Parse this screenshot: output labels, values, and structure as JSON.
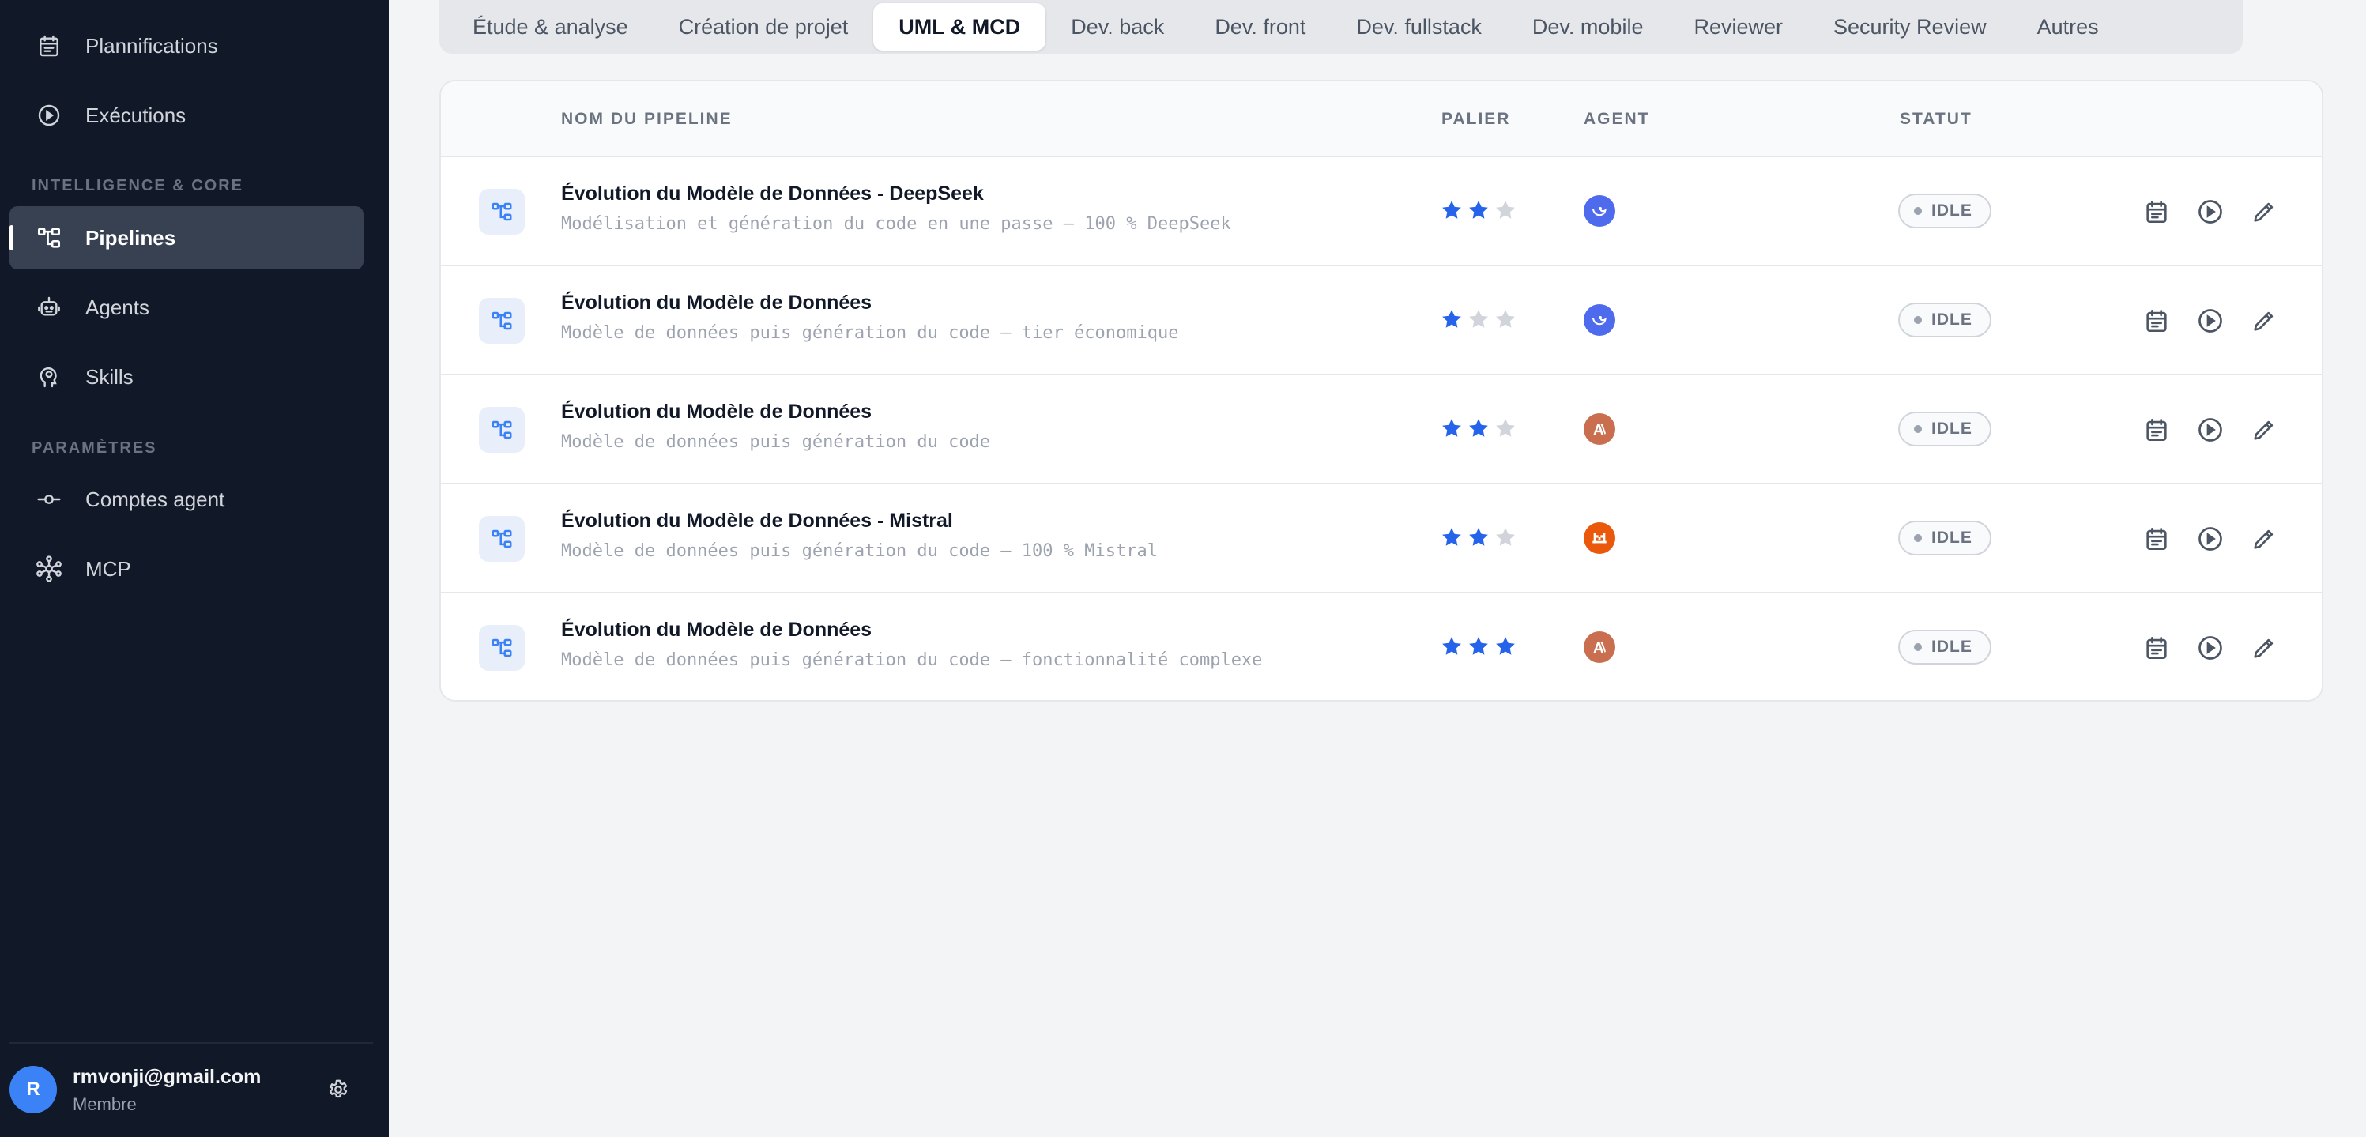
{
  "sidebar": {
    "items_top": [
      {
        "label": "Plannifications",
        "icon": "calendar-icon"
      },
      {
        "label": "Exécutions",
        "icon": "play-circle-icon"
      }
    ],
    "section_core": "INTELLIGENCE & CORE",
    "items_core": [
      {
        "label": "Pipelines",
        "icon": "pipeline-icon",
        "active": true
      },
      {
        "label": "Agents",
        "icon": "robot-icon"
      },
      {
        "label": "Skills",
        "icon": "skill-head-icon"
      }
    ],
    "section_params": "PARAMÈTRES",
    "items_params": [
      {
        "label": "Comptes agent",
        "icon": "commit-icon"
      },
      {
        "label": "MCP",
        "icon": "network-icon"
      }
    ],
    "user": {
      "initial": "R",
      "email": "rmvonji@gmail.com",
      "role": "Membre"
    }
  },
  "tabs": [
    {
      "label": "Étude & analyse"
    },
    {
      "label": "Création de projet"
    },
    {
      "label": "UML & MCD",
      "active": true
    },
    {
      "label": "Dev. back"
    },
    {
      "label": "Dev. front"
    },
    {
      "label": "Dev. fullstack"
    },
    {
      "label": "Dev. mobile"
    },
    {
      "label": "Reviewer"
    },
    {
      "label": "Security Review"
    },
    {
      "label": "Autres"
    }
  ],
  "table": {
    "headers": {
      "name": "NOM DU PIPELINE",
      "tier": "PALIER",
      "agent": "AGENT",
      "status": "STATUT"
    },
    "rows": [
      {
        "name": "Évolution du Modèle de Données - DeepSeek",
        "desc": "Modélisation et génération du code en une passe — 100 % DeepSeek",
        "tier": 2,
        "agent": "deepseek",
        "status": "IDLE"
      },
      {
        "name": "Évolution du Modèle de Données",
        "desc": "Modèle de données puis génération du code — tier économique",
        "tier": 1,
        "agent": "deepseek",
        "status": "IDLE"
      },
      {
        "name": "Évolution du Modèle de Données",
        "desc": "Modèle de données puis génération du code",
        "tier": 2,
        "agent": "anthropic",
        "status": "IDLE"
      },
      {
        "name": "Évolution du Modèle de Données - Mistral",
        "desc": "Modèle de données puis génération du code — 100 % Mistral",
        "tier": 2,
        "agent": "mistral",
        "status": "IDLE"
      },
      {
        "name": "Évolution du Modèle de Données",
        "desc": "Modèle de données puis génération du code — fonctionnalité complexe",
        "tier": 3,
        "agent": "anthropic",
        "status": "IDLE"
      }
    ]
  },
  "colors": {
    "star_on": "#2563eb",
    "star_off": "#d1d5db",
    "deepseek": "#4f6bed",
    "anthropic": "#c96f4f",
    "mistral": "#ea580c"
  }
}
